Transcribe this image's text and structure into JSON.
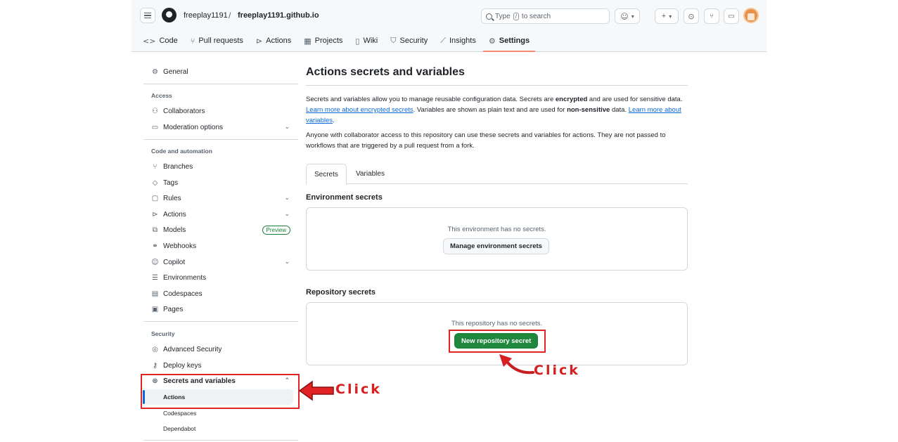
{
  "header": {
    "owner": "freeplay1191",
    "separator": "/",
    "repo": "freeplay1191.github.io",
    "search_prefix": "Type",
    "search_key": "/",
    "search_suffix": "to search",
    "nav": [
      {
        "label": "Code",
        "icon": "code-icon"
      },
      {
        "label": "Pull requests",
        "icon": "pull-request-icon"
      },
      {
        "label": "Actions",
        "icon": "play-icon"
      },
      {
        "label": "Projects",
        "icon": "table-icon"
      },
      {
        "label": "Wiki",
        "icon": "book-icon"
      },
      {
        "label": "Security",
        "icon": "shield-icon"
      },
      {
        "label": "Insights",
        "icon": "graph-icon"
      },
      {
        "label": "Settings",
        "icon": "gear-icon"
      }
    ],
    "active_tab": "Settings",
    "accent": "#fd8c73"
  },
  "sidebar": {
    "general": "General",
    "access_heading": "Access",
    "collaborators": "Collaborators",
    "moderation": "Moderation options",
    "code_heading": "Code and automation",
    "branches": "Branches",
    "tags": "Tags",
    "rules": "Rules",
    "actions": "Actions",
    "models": "Models",
    "models_badge": "Preview",
    "webhooks": "Webhooks",
    "copilot": "Copilot",
    "environments": "Environments",
    "codespaces": "Codespaces",
    "pages": "Pages",
    "security_heading": "Security",
    "advanced_security": "Advanced Security",
    "deploy_keys": "Deploy keys",
    "secrets": "Secrets and variables",
    "sub_actions": "Actions",
    "sub_codespaces": "Codespaces",
    "sub_dependabot": "Dependabot"
  },
  "main": {
    "title": "Actions secrets and variables",
    "p1_a": "Secrets and variables allow you to manage reusable configuration data. Secrets are ",
    "p1_b": "encrypted",
    "p1_c": " and are used for sensitive data. ",
    "p1_link1": "Learn more about encrypted secrets",
    "p1_d": ". Variables are shown as plain text and are used for ",
    "p1_e": "non-sensitive",
    "p1_f": " data. ",
    "p1_link2": "Learn more about variables",
    "p1_g": ".",
    "p2": "Anyone with collaborator access to this repository can use these secrets and variables for actions. They are not passed to workflows that are triggered by a pull request from a fork.",
    "tabs": [
      "Secrets",
      "Variables"
    ],
    "env_title": "Environment secrets",
    "env_msg": "This environment has no secrets.",
    "env_button": "Manage environment secrets",
    "repo_title": "Repository secrets",
    "repo_msg": "This repository has no secrets.",
    "repo_button": "New repository secret",
    "primary_color": "#1f883d"
  },
  "annotations": {
    "click1": "Click",
    "click2": "Click",
    "color": "#e02424"
  }
}
